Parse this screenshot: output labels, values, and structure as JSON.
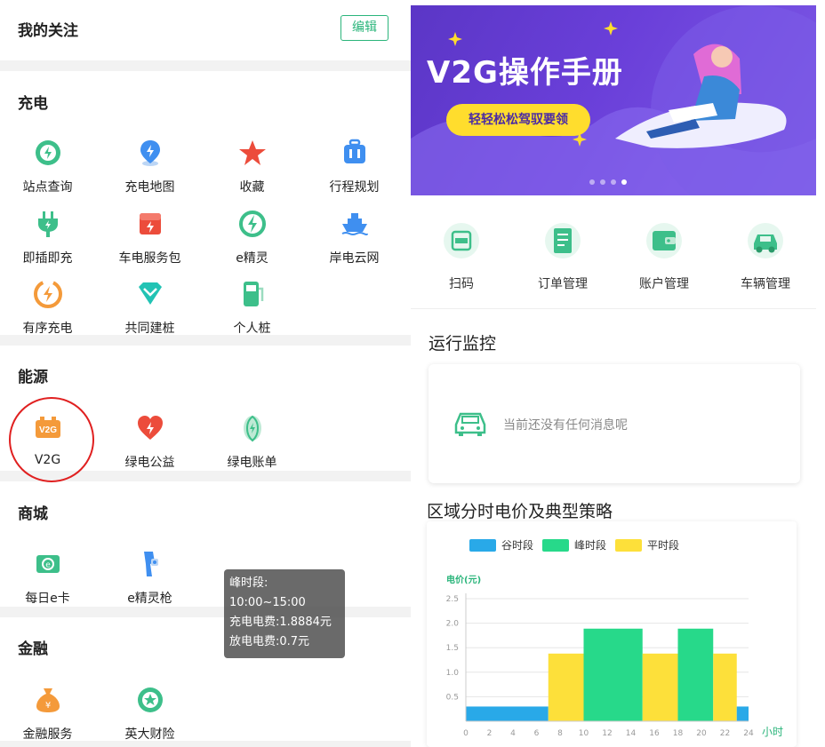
{
  "favorites": {
    "title": "我的关注",
    "edit_label": "编辑"
  },
  "sections": [
    {
      "title": "充电",
      "items": [
        {
          "label": "站点查询",
          "icon": "station-search-icon"
        },
        {
          "label": "充电地图",
          "icon": "charging-map-icon"
        },
        {
          "label": "收藏",
          "icon": "star-icon"
        },
        {
          "label": "行程规划",
          "icon": "trip-plan-icon"
        },
        {
          "label": "即插即充",
          "icon": "plug-icon"
        },
        {
          "label": "车电服务包",
          "icon": "service-pack-icon"
        },
        {
          "label": "e精灵",
          "icon": "e-spirit-icon"
        },
        {
          "label": "岸电云网",
          "icon": "ship-icon"
        },
        {
          "label": "有序充电",
          "icon": "ordered-charge-icon"
        },
        {
          "label": "共同建桩",
          "icon": "co-build-icon"
        },
        {
          "label": "个人桩",
          "icon": "personal-pile-icon"
        }
      ]
    },
    {
      "title": "能源",
      "items": [
        {
          "label": "V2G",
          "icon": "v2g-icon"
        },
        {
          "label": "绿电公益",
          "icon": "heart-icon"
        },
        {
          "label": "绿电账单",
          "icon": "leaf-icon"
        }
      ]
    },
    {
      "title": "商城",
      "items": [
        {
          "label": "每日e卡",
          "icon": "card-icon"
        },
        {
          "label": "e精灵枪",
          "icon": "charge-gun-icon"
        }
      ]
    },
    {
      "title": "金融",
      "items": [
        {
          "label": "金融服务",
          "icon": "money-bag-icon"
        },
        {
          "label": "英大财险",
          "icon": "insurance-icon"
        }
      ]
    }
  ],
  "banner": {
    "title": "V2G操作手册",
    "pill": "轻轻松松驾驭要领",
    "logo_text": "V2G"
  },
  "quick": [
    {
      "label": "扫码",
      "icon": "scan-icon"
    },
    {
      "label": "订单管理",
      "icon": "order-icon"
    },
    {
      "label": "账户管理",
      "icon": "wallet-icon"
    },
    {
      "label": "车辆管理",
      "icon": "car-icon"
    }
  ],
  "run": {
    "title": "运行监控",
    "empty": "当前还没有任何消息呢"
  },
  "price": {
    "title": "区域分时电价及典型策略"
  },
  "colors": {
    "green": "#2bb57b",
    "valley": "#29a9e8",
    "peak": "#27d98a",
    "flat": "#fde03a",
    "banner": "#6a3fd9"
  },
  "chart_data": {
    "type": "bar",
    "ylabel": "电价(元)",
    "xlabel": "小时",
    "ylim": [
      0,
      2.5
    ],
    "xlim": [
      0,
      24
    ],
    "yticks": [
      "0.5",
      "1.0",
      "1.5",
      "2.0",
      "2.5"
    ],
    "xticks": [
      "0",
      "2",
      "4",
      "6",
      "8",
      "10",
      "12",
      "14",
      "16",
      "18",
      "20",
      "22",
      "24"
    ],
    "legend": [
      "谷时段",
      "峰时段",
      "平时段"
    ],
    "segments": [
      {
        "period": "谷时段",
        "start": 0,
        "end": 7,
        "value": 0.3
      },
      {
        "period": "平时段",
        "start": 7,
        "end": 10,
        "value": 1.38
      },
      {
        "period": "峰时段",
        "start": 10,
        "end": 15,
        "value": 1.8884
      },
      {
        "period": "平时段",
        "start": 15,
        "end": 18,
        "value": 1.38
      },
      {
        "period": "峰时段",
        "start": 18,
        "end": 21,
        "value": 1.8884
      },
      {
        "period": "平时段",
        "start": 21,
        "end": 23,
        "value": 1.38
      },
      {
        "period": "谷时段",
        "start": 23,
        "end": 24,
        "value": 0.3
      }
    ],
    "tooltip": {
      "title": "峰时段:",
      "time": "10:00~15:00",
      "charge": "充电电费:1.8884元",
      "discharge": "放电电费:0.7元"
    }
  }
}
